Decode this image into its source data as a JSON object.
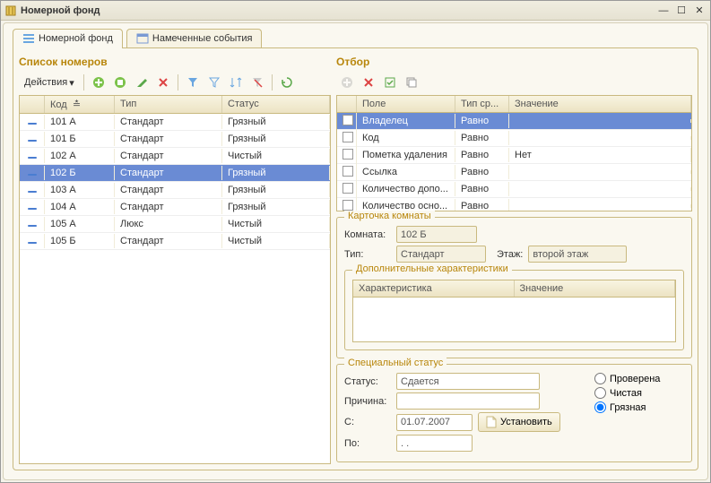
{
  "window": {
    "title": "Номерной фонд"
  },
  "tabs": [
    {
      "label": "Номерной фонд",
      "active": true
    },
    {
      "label": "Намеченные события",
      "active": false
    }
  ],
  "left": {
    "title": "Список номеров",
    "actions_label": "Действия",
    "cols": {
      "code": "Код",
      "type": "Тип",
      "status": "Статус"
    },
    "rows": [
      {
        "code": "101 А",
        "type": "Стандарт",
        "status": "Грязный",
        "sel": false
      },
      {
        "code": "101 Б",
        "type": "Стандарт",
        "status": "Грязный",
        "sel": false
      },
      {
        "code": "102 А",
        "type": "Стандарт",
        "status": "Чистый",
        "sel": false
      },
      {
        "code": "102 Б",
        "type": "Стандарт",
        "status": "Грязный",
        "sel": true
      },
      {
        "code": "103 А",
        "type": "Стандарт",
        "status": "Грязный",
        "sel": false
      },
      {
        "code": "104 А",
        "type": "Стандарт",
        "status": "Грязный",
        "sel": false
      },
      {
        "code": "105 А",
        "type": "Люкс",
        "status": "Чистый",
        "sel": false
      },
      {
        "code": "105 Б",
        "type": "Стандарт",
        "status": "Чистый",
        "sel": false
      }
    ]
  },
  "right": {
    "title": "Отбор",
    "cols": {
      "field": "Поле",
      "cmp": "Тип ср...",
      "val": "Значение"
    },
    "rows": [
      {
        "field": "Владелец",
        "cmp": "Равно",
        "val": "",
        "sel": true
      },
      {
        "field": "Код",
        "cmp": "Равно",
        "val": "",
        "sel": false
      },
      {
        "field": "Пометка удаления",
        "cmp": "Равно",
        "val": "Нет",
        "sel": false
      },
      {
        "field": "Ссылка",
        "cmp": "Равно",
        "val": "",
        "sel": false
      },
      {
        "field": "Количество допо...",
        "cmp": "Равно",
        "val": "",
        "sel": false
      },
      {
        "field": "Количество осно...",
        "cmp": "Равно",
        "val": "",
        "sel": false
      }
    ]
  },
  "card": {
    "legend": "Карточка комнаты",
    "room_lbl": "Комната:",
    "room": "102 Б",
    "type_lbl": "Тип:",
    "type": "Стандарт",
    "floor_lbl": "Этаж:",
    "floor": "второй этаж"
  },
  "extra": {
    "legend": "Дополнительные характеристики",
    "col1": "Характеристика",
    "col2": "Значение"
  },
  "status": {
    "legend": "Специальный статус",
    "status_lbl": "Статус:",
    "status_val": "Сдается",
    "reason_lbl": "Причина:",
    "reason_val": "",
    "from_lbl": "С:",
    "from_val": "01.07.2007",
    "to_lbl": "По:",
    "to_val": ". .",
    "set_btn": "Установить",
    "radios": {
      "checked": "Проверена",
      "clean": "Чистая",
      "dirty": "Грязная",
      "selected": "dirty"
    }
  },
  "colors": {
    "accent": "#b8860b",
    "select": "#6a8bd4"
  }
}
